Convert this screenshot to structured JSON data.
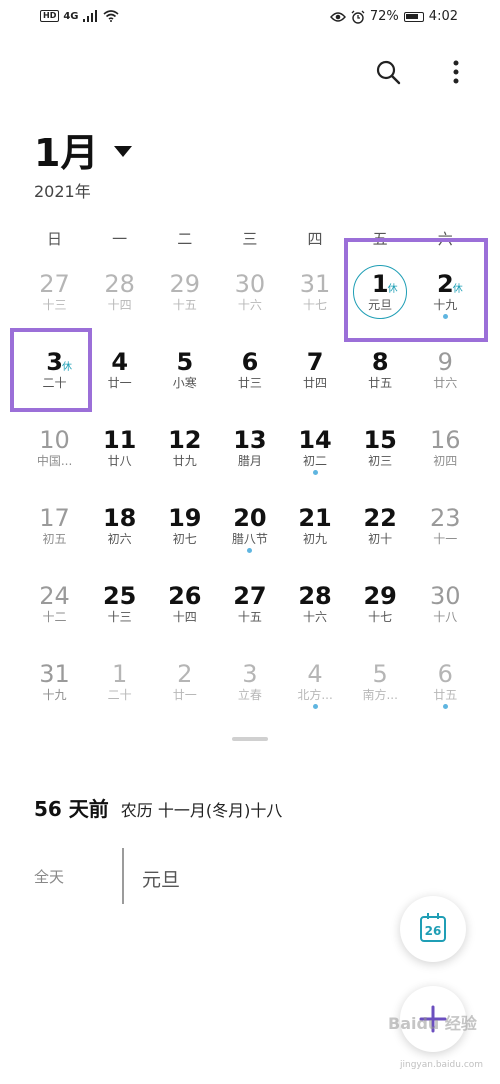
{
  "status": {
    "hd": "HD",
    "network": "4G",
    "battery": "72%",
    "time": "4:02"
  },
  "header": {
    "month": "1月",
    "year": "2021年"
  },
  "weekdays": [
    "日",
    "一",
    "二",
    "三",
    "四",
    "五",
    "六"
  ],
  "weeks": [
    [
      {
        "n": "27",
        "s": "十三",
        "dim": true
      },
      {
        "n": "28",
        "s": "十四",
        "dim": true
      },
      {
        "n": "29",
        "s": "十五",
        "dim": true
      },
      {
        "n": "30",
        "s": "十六",
        "dim": true
      },
      {
        "n": "31",
        "s": "十七",
        "dim": true
      },
      {
        "n": "1",
        "s": "元旦",
        "rest": "休",
        "today": true
      },
      {
        "n": "2",
        "s": "十九",
        "rest": "休",
        "dot": true
      }
    ],
    [
      {
        "n": "3",
        "s": "二十",
        "rest": "休"
      },
      {
        "n": "4",
        "s": "廿一"
      },
      {
        "n": "5",
        "s": "小寒"
      },
      {
        "n": "6",
        "s": "廿三"
      },
      {
        "n": "7",
        "s": "廿四"
      },
      {
        "n": "8",
        "s": "廿五"
      },
      {
        "n": "9",
        "s": "廿六",
        "weekend": true
      }
    ],
    [
      {
        "n": "10",
        "s": "中国...",
        "weekend": true
      },
      {
        "n": "11",
        "s": "廿八"
      },
      {
        "n": "12",
        "s": "廿九"
      },
      {
        "n": "13",
        "s": "腊月"
      },
      {
        "n": "14",
        "s": "初二",
        "dot": true
      },
      {
        "n": "15",
        "s": "初三"
      },
      {
        "n": "16",
        "s": "初四",
        "weekend": true
      }
    ],
    [
      {
        "n": "17",
        "s": "初五",
        "weekend": true
      },
      {
        "n": "18",
        "s": "初六"
      },
      {
        "n": "19",
        "s": "初七"
      },
      {
        "n": "20",
        "s": "腊八节",
        "dot": true
      },
      {
        "n": "21",
        "s": "初九"
      },
      {
        "n": "22",
        "s": "初十"
      },
      {
        "n": "23",
        "s": "十一",
        "weekend": true
      }
    ],
    [
      {
        "n": "24",
        "s": "十二",
        "weekend": true
      },
      {
        "n": "25",
        "s": "十三"
      },
      {
        "n": "26",
        "s": "十四"
      },
      {
        "n": "27",
        "s": "十五"
      },
      {
        "n": "28",
        "s": "十六"
      },
      {
        "n": "29",
        "s": "十七"
      },
      {
        "n": "30",
        "s": "十八",
        "weekend": true
      }
    ],
    [
      {
        "n": "31",
        "s": "十九",
        "weekend": true
      },
      {
        "n": "1",
        "s": "二十",
        "dim": true
      },
      {
        "n": "2",
        "s": "廿一",
        "dim": true
      },
      {
        "n": "3",
        "s": "立春",
        "dim": true
      },
      {
        "n": "4",
        "s": "北方...",
        "dim": true,
        "dot": true
      },
      {
        "n": "5",
        "s": "南方...",
        "dim": true
      },
      {
        "n": "6",
        "s": "廿五",
        "dim": true,
        "dot": true
      }
    ]
  ],
  "info": {
    "days_ago": "56 天前",
    "lunar": "农历 十一月(冬月)十八"
  },
  "event": {
    "allday": "全天",
    "title": "元旦"
  },
  "fab": {
    "today_day": "26"
  },
  "watermark": {
    "text": "Baidu 经验",
    "sub": "jingyan.baidu.com"
  },
  "colors": {
    "accent": "#1f9eb5",
    "highlight_box": "#9b6fd8",
    "fab_plus": "#6b4fbf"
  }
}
